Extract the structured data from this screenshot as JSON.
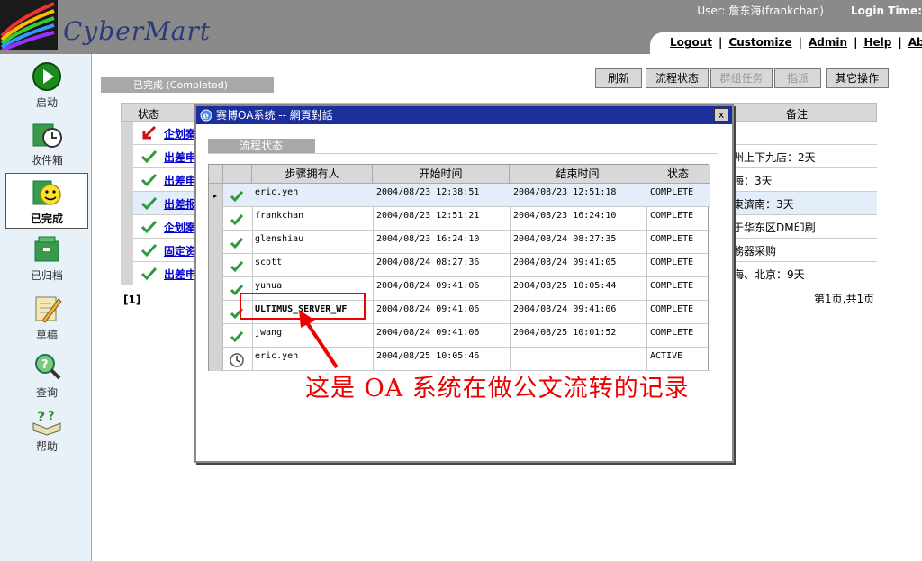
{
  "header": {
    "logo_text": "CyberMart",
    "user": "User: 詹东海(frankchan)",
    "login_time": "Login Time:",
    "nav": [
      "Logout",
      "Customize",
      "Admin",
      "Help",
      "About"
    ]
  },
  "sidebar": {
    "items": [
      {
        "label": "启动",
        "icon": "start-icon"
      },
      {
        "label": "收件箱",
        "icon": "inbox-icon"
      },
      {
        "label": "已完成",
        "icon": "completed-icon",
        "active": true
      },
      {
        "label": "已归档",
        "icon": "archive-icon"
      },
      {
        "label": "草稿",
        "icon": "draft-icon"
      },
      {
        "label": "查询",
        "icon": "query-icon"
      },
      {
        "label": "帮助",
        "icon": "help-icon"
      }
    ]
  },
  "main": {
    "tab_label": "已完成 (Completed)",
    "toolbar": [
      {
        "label": "刷新",
        "enabled": true
      },
      {
        "label": "流程状态",
        "enabled": true
      },
      {
        "label": "群组任务",
        "enabled": false
      },
      {
        "label": "指派",
        "enabled": false
      },
      {
        "label": "其它操作",
        "enabled": true
      }
    ],
    "table": {
      "status_header": "状态",
      "note_header": "备注",
      "rows": [
        {
          "status": "returned",
          "title": "企划案",
          "note": ""
        },
        {
          "status": "done",
          "title": "出差申",
          "note": "州上下九店：2天"
        },
        {
          "status": "done",
          "title": "出差申",
          "note": "海：3天"
        },
        {
          "status": "done",
          "title": "出差报",
          "note": "東濟南：3天"
        },
        {
          "status": "done",
          "title": "企划案",
          "note": "于华东区DM印刷"
        },
        {
          "status": "done",
          "title": "固定资",
          "note": "務器采购"
        },
        {
          "status": "done",
          "title": "出差申",
          "note": "海、北京：9天"
        }
      ]
    },
    "pager_left": "[1]",
    "pager_right": "第1页,共1页"
  },
  "dialog": {
    "title": "赛博OA系统 -- 網頁對話",
    "close_label": "x",
    "tab_label": "流程状态",
    "columns": [
      "步骤拥有人",
      "开始时间",
      "结束时间",
      "状态"
    ],
    "rows": [
      {
        "owner": "eric.yeh",
        "start": "2004/08/23 12:38:51",
        "end": "2004/08/23 12:51:18",
        "state": "COMPLETE",
        "icon": "check"
      },
      {
        "owner": "frankchan",
        "start": "2004/08/23 12:51:21",
        "end": "2004/08/23 16:24:10",
        "state": "COMPLETE",
        "icon": "check"
      },
      {
        "owner": "glenshiau",
        "start": "2004/08/23 16:24:10",
        "end": "2004/08/24 08:27:35",
        "state": "COMPLETE",
        "icon": "check"
      },
      {
        "owner": "scott",
        "start": "2004/08/24 08:27:36",
        "end": "2004/08/24 09:41:05",
        "state": "COMPLETE",
        "icon": "check"
      },
      {
        "owner": "yuhua",
        "start": "2004/08/24 09:41:06",
        "end": "2004/08/25 10:05:44",
        "state": "COMPLETE",
        "icon": "check"
      },
      {
        "owner": "ULTIMUS_SERVER_WF",
        "start": "2004/08/24 09:41:06",
        "end": "2004/08/24 09:41:06",
        "state": "COMPLETE",
        "icon": "check"
      },
      {
        "owner": "jwang",
        "start": "2004/08/24 09:41:06",
        "end": "2004/08/25 10:01:52",
        "state": "COMPLETE",
        "icon": "check"
      },
      {
        "owner": "eric.yeh",
        "start": "2004/08/25 10:05:46",
        "end": "",
        "state": "ACTIVE",
        "icon": "clock"
      }
    ]
  },
  "annotation": "这是 OA 系统在做公文流转的记录",
  "colors": {
    "accent": "#1a2e9c",
    "annotation": "#ee0000",
    "check": "#2e9a3a"
  }
}
